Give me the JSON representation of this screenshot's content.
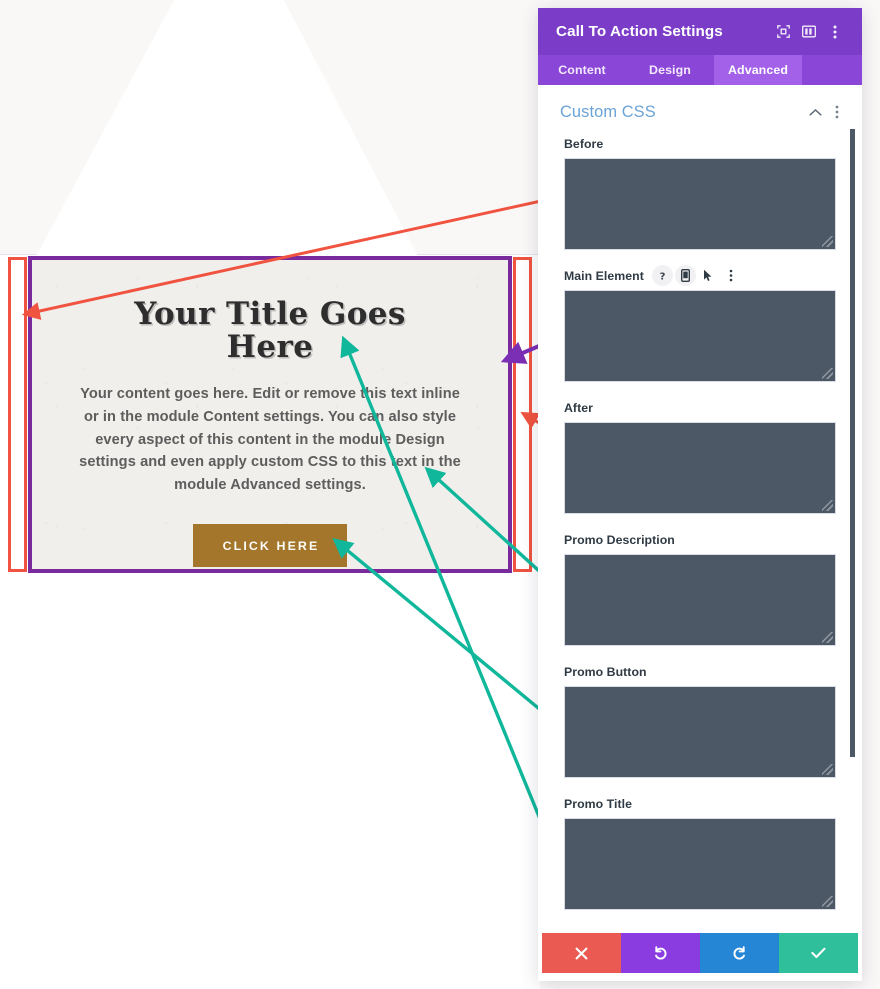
{
  "canvas": {
    "cta": {
      "title": "Your Title Goes Here",
      "body": "Your content goes here. Edit or remove this text inline or in the module Content settings. You can also style every aspect of this content in the module Design settings and even apply custom CSS to this text in the module Advanced settings.",
      "button_label": "CLICK HERE",
      "button_color": "#a3762b",
      "module_border_color": "#792a9c"
    },
    "annotations": {
      "before_highlight_color": "#f0533f",
      "after_highlight_color": "#f0533f",
      "main_element_arrow_color": "#7b2fb5",
      "inner_element_arrow_color": "#10b79a"
    }
  },
  "panel": {
    "header": {
      "title": "Call To Action Settings",
      "background": "#7b3dc8",
      "icons": [
        {
          "name": "focus-frame-icon"
        },
        {
          "name": "layout-columns-icon"
        },
        {
          "name": "more-vertical-icon"
        }
      ]
    },
    "tabs": [
      {
        "label": "Content",
        "active": false
      },
      {
        "label": "Design",
        "active": false
      },
      {
        "label": "Advanced",
        "active": true
      }
    ],
    "section": {
      "title": "Custom CSS",
      "title_color": "#6ba3d6",
      "collapse_icon": "chevron-up-icon",
      "menu_icon": "more-vertical-icon"
    },
    "fields": [
      {
        "label": "Before",
        "value": "",
        "placeholder": "",
        "icons": []
      },
      {
        "label": "Main Element",
        "value": "",
        "placeholder": "",
        "icons": [
          {
            "name": "help-icon",
            "glyph": "?"
          },
          {
            "name": "responsive-device-icon"
          },
          {
            "name": "hover-cursor-icon"
          },
          {
            "name": "more-vertical-icon"
          }
        ]
      },
      {
        "label": "After",
        "value": "",
        "placeholder": "",
        "icons": []
      },
      {
        "label": "Promo Description",
        "value": "",
        "placeholder": "",
        "icons": []
      },
      {
        "label": "Promo Button",
        "value": "",
        "placeholder": "",
        "icons": []
      },
      {
        "label": "Promo Title",
        "value": "",
        "placeholder": "",
        "icons": []
      }
    ],
    "footer": [
      {
        "name": "cancel-button",
        "icon": "close-icon",
        "color": "#ea5a53"
      },
      {
        "name": "undo-button",
        "icon": "undo-arrow-icon",
        "color": "#8b3ce0"
      },
      {
        "name": "redo-button",
        "icon": "redo-arrow-icon",
        "color": "#2586d6"
      },
      {
        "name": "save-button",
        "icon": "check-icon",
        "color": "#2fbf9a"
      }
    ]
  }
}
